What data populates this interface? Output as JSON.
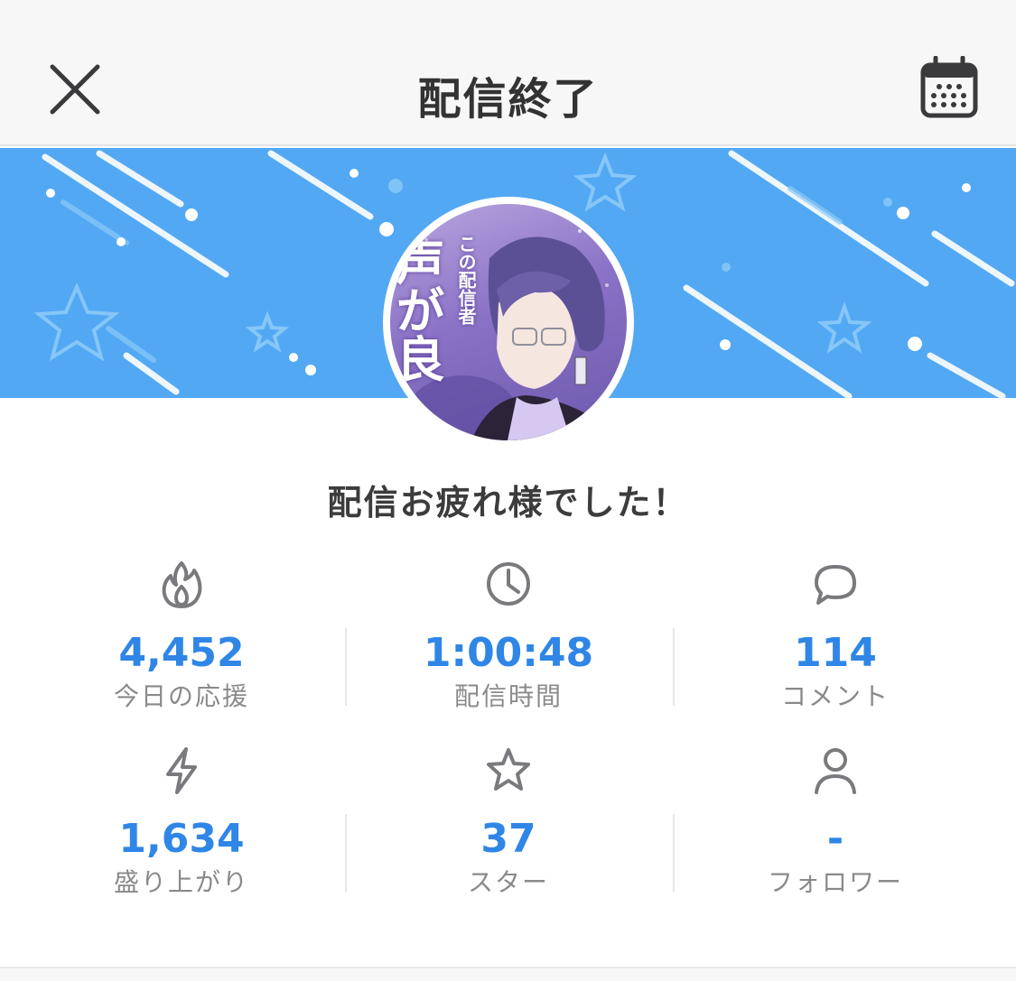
{
  "header": {
    "title": "配信終了",
    "close_icon": "close-icon",
    "calendar_icon": "calendar-icon"
  },
  "banner": {
    "background_color": "#52a8f3",
    "avatar_text_small": "この配信者",
    "avatar_text_big": "声が良"
  },
  "message": "配信お疲れ様でした！",
  "stats": [
    {
      "icon": "flame-icon",
      "value": "4,452",
      "label": "今日の応援"
    },
    {
      "icon": "clock-icon",
      "value": "1:00:48",
      "label": "配信時間"
    },
    {
      "icon": "comment-icon",
      "value": "114",
      "label": "コメント"
    },
    {
      "icon": "lightning-icon",
      "value": "1,634",
      "label": "盛り上がり"
    },
    {
      "icon": "star-icon",
      "value": "37",
      "label": "スター"
    },
    {
      "icon": "person-icon",
      "value": "-",
      "label": "フォロワー"
    }
  ],
  "colors": {
    "accent": "#2f86e6",
    "title_text": "#333333",
    "label_text": "#8a8a8a",
    "icon_stroke": "#7a7a7e"
  }
}
